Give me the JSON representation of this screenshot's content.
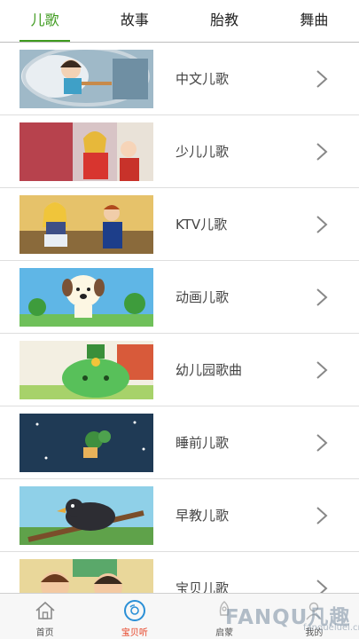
{
  "tabs": [
    {
      "label": "儿歌",
      "active": true
    },
    {
      "label": "故事",
      "active": false
    },
    {
      "label": "胎教",
      "active": false
    },
    {
      "label": "舞曲",
      "active": false
    }
  ],
  "categories": [
    {
      "label": "中文儿歌"
    },
    {
      "label": "少儿儿歌"
    },
    {
      "label": "KTV儿歌"
    },
    {
      "label": "动画儿歌"
    },
    {
      "label": "幼儿园歌曲"
    },
    {
      "label": "睡前儿歌"
    },
    {
      "label": "早教儿歌"
    },
    {
      "label": "宝贝儿歌"
    }
  ],
  "bottom_nav": [
    {
      "label": "首页",
      "icon": "home-icon",
      "active": false
    },
    {
      "label": "宝贝听",
      "icon": "disc-icon",
      "active": true
    },
    {
      "label": "启蒙",
      "icon": "rocket-icon",
      "active": false
    },
    {
      "label": "我的",
      "icon": "person-icon",
      "active": false
    }
  ],
  "watermark": {
    "text": "FANQU凡趣",
    "url": "fanqueluel.cn"
  },
  "colors": {
    "accent": "#3f9b1f",
    "nav_active": "#e63c1e",
    "chevron": "#888888"
  }
}
